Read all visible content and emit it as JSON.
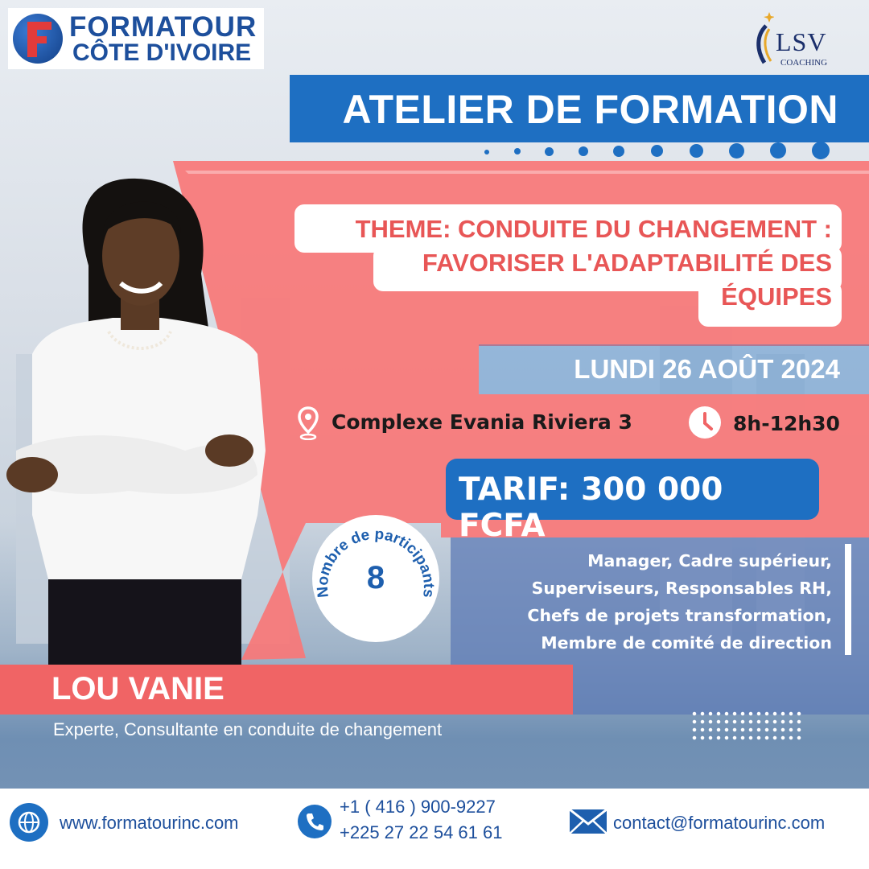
{
  "brand": {
    "left_logo_line1": "FORMATOUR",
    "left_logo_line2": "CÔTE D'IVOIRE",
    "right_logo_name": "LSV",
    "right_logo_sub": "COACHING"
  },
  "header": {
    "title": "ATELIER DE FORMATION"
  },
  "theme": {
    "lines": [
      "THEME: CONDUITE DU CHANGEMENT :",
      "FAVORISER L'ADAPTABILITÉ DES",
      "ÉQUIPES"
    ]
  },
  "event": {
    "date": "LUNDI 26 AOÛT 2024",
    "location": "Complexe Evania Riviera 3",
    "time": "8h-12h30",
    "price": "TARIF: 300 000 FCFA"
  },
  "participants": {
    "label": "Nombre de participants",
    "count": "8"
  },
  "audience": {
    "lines": [
      "Manager, Cadre supérieur,",
      "Superviseurs, Responsables RH,",
      "Chefs de projets transformation,",
      "Membre de comité de direction"
    ]
  },
  "speaker": {
    "name": "LOU VANIE",
    "role": "Experte, Consultante en conduite de changement"
  },
  "footer": {
    "website": "www.formatourinc.com",
    "phone1": "+1  ( 416 ) 900-9227",
    "phone2": "+225 27 22 54 61 61",
    "email": "contact@formatourinc.com"
  },
  "icons": {
    "location": "map-pin-icon",
    "time": "clock-icon",
    "website": "globe-icon",
    "phone": "phone-icon",
    "email": "envelope-icon"
  },
  "colors": {
    "primary_blue": "#1e6fc2",
    "salmon": "#f06465",
    "theme_red": "#e85656"
  }
}
